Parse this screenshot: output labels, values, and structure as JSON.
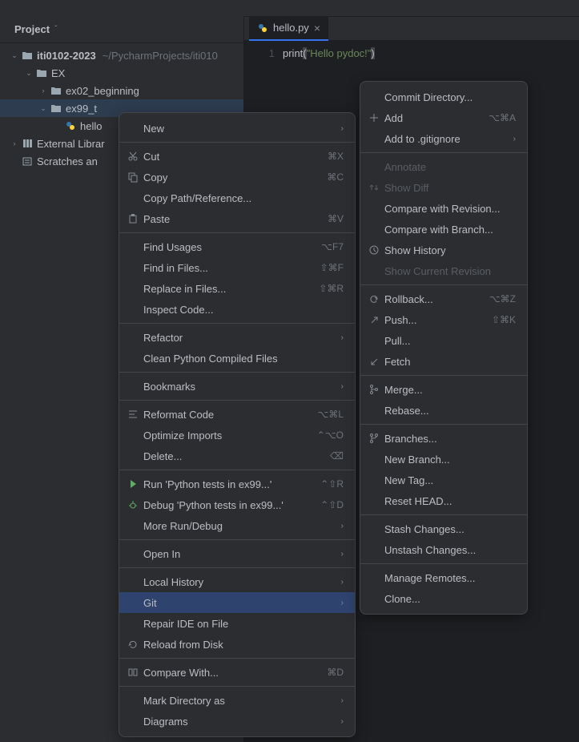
{
  "panel": {
    "title": "Project"
  },
  "tree": {
    "root": {
      "label": "iti0102-2023",
      "hint": "~/PycharmProjects/iti010"
    },
    "ex": {
      "label": "EX"
    },
    "ex02": {
      "label": "ex02_beginning"
    },
    "ex99": {
      "label": "ex99_t"
    },
    "hello": {
      "label": "hello"
    },
    "extlib": {
      "label": "External Librar"
    },
    "scratch": {
      "label": "Scratches an"
    }
  },
  "tab": {
    "label": "hello.py"
  },
  "editor": {
    "line_num": "1",
    "func": "print",
    "paren_open": "(",
    "string": "\"Hello pydoc!\"",
    "paren_close": ")"
  },
  "menu1": {
    "new": "New",
    "cut": "Cut",
    "cut_sc": "⌘X",
    "copy": "Copy",
    "copy_sc": "⌘C",
    "copy_path": "Copy Path/Reference...",
    "paste": "Paste",
    "paste_sc": "⌘V",
    "find_usages": "Find Usages",
    "find_usages_sc": "⌥F7",
    "find_in_files": "Find in Files...",
    "find_in_files_sc": "⇧⌘F",
    "replace_in_files": "Replace in Files...",
    "replace_in_files_sc": "⇧⌘R",
    "inspect": "Inspect Code...",
    "refactor": "Refactor",
    "clean_py": "Clean Python Compiled Files",
    "bookmarks": "Bookmarks",
    "reformat": "Reformat Code",
    "reformat_sc": "⌥⌘L",
    "optimize": "Optimize Imports",
    "optimize_sc": "⌃⌥O",
    "delete": "Delete...",
    "delete_sc": "⌫",
    "run": "Run 'Python tests in ex99...'",
    "run_sc": "⌃⇧R",
    "debug": "Debug 'Python tests in ex99...'",
    "debug_sc": "⌃⇧D",
    "more_run": "More Run/Debug",
    "open_in": "Open In",
    "local_history": "Local History",
    "git": "Git",
    "repair": "Repair IDE on File",
    "reload": "Reload from Disk",
    "compare": "Compare With...",
    "compare_sc": "⌘D",
    "mark_dir": "Mark Directory as",
    "diagrams": "Diagrams"
  },
  "menu2": {
    "commit": "Commit Directory...",
    "add": "Add",
    "add_sc": "⌥⌘A",
    "gitignore": "Add to .gitignore",
    "annotate": "Annotate",
    "show_diff": "Show Diff",
    "compare_rev": "Compare with Revision...",
    "compare_branch": "Compare with Branch...",
    "show_history": "Show History",
    "show_current": "Show Current Revision",
    "rollback": "Rollback...",
    "rollback_sc": "⌥⌘Z",
    "push": "Push...",
    "push_sc": "⇧⌘K",
    "pull": "Pull...",
    "fetch": "Fetch",
    "merge": "Merge...",
    "rebase": "Rebase...",
    "branches": "Branches...",
    "new_branch": "New Branch...",
    "new_tag": "New Tag...",
    "reset_head": "Reset HEAD...",
    "stash": "Stash Changes...",
    "unstash": "Unstash Changes...",
    "manage_remotes": "Manage Remotes...",
    "clone": "Clone..."
  }
}
